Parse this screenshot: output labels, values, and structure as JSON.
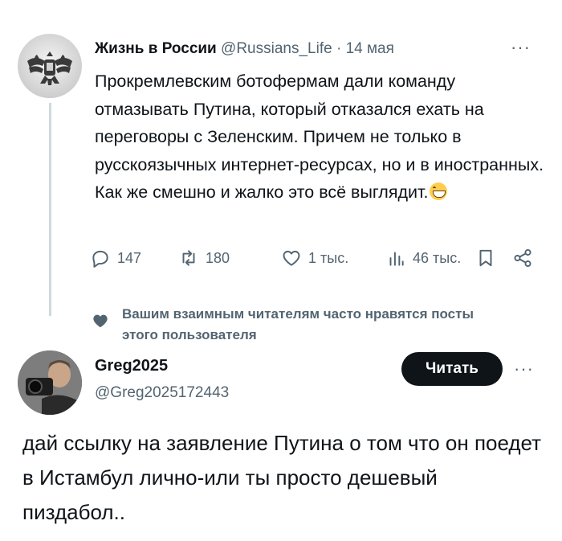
{
  "tweet": {
    "author_name": "Жизнь в России",
    "author_handle": "@Russians_Life",
    "separator": "·",
    "date": "14 мая",
    "more_glyph": "···",
    "text": "Прокремлевским ботофермам дали команду отмазывать Путина, который отказался ехать на переговоры с Зеленским. Причем не только в русскоязычных интернет-ресурсах, но и в иностранных. Как же смешно и жалко это всё выглядит.",
    "emoji": "grinning-face-with-smiling-eyes",
    "actions": {
      "replies": "147",
      "reposts": "180",
      "likes": "1 тыс.",
      "views": "46 тыс."
    },
    "avatar": "double-headed-eagle-emblem"
  },
  "social_context": {
    "icon": "heart-icon",
    "text": "Вашим взаимным читателям часто нравятся посты этого пользователя"
  },
  "user": {
    "name": "Greg2025",
    "handle": "@Greg2025172443",
    "follow_label": "Читать",
    "more_glyph": "···",
    "avatar": "photographer-with-camera-photo"
  },
  "reply": {
    "text": "дай ссылку на заявление Путина о том что он поедет в Истамбул лично-или ты просто дешевый пиздабол.."
  },
  "colors": {
    "text": "#0f1419",
    "secondary": "#536471",
    "thread_line": "#cfd9de",
    "button_bg": "#0f1419"
  }
}
